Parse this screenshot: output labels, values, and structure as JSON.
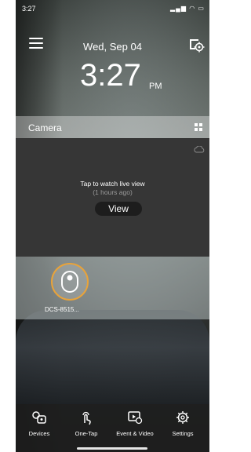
{
  "status_bar": {
    "time": "3:27",
    "icons": "▂▄▆ ◠ ▭"
  },
  "header": {
    "date": "Wed, Sep 04",
    "time": "3:27",
    "ampm": "PM"
  },
  "camera": {
    "section_label": "Camera",
    "tap_text": "Tap to watch live view",
    "ago_text": "(1 hours ago)",
    "view_label": "View"
  },
  "device": {
    "name": "DCS-8515..."
  },
  "nav": [
    {
      "label": "Devices",
      "icon": "devices-icon"
    },
    {
      "label": "One-Tap",
      "icon": "one-tap-icon"
    },
    {
      "label": "Event & Video",
      "icon": "event-video-icon"
    },
    {
      "label": "Settings",
      "icon": "settings-icon"
    }
  ],
  "colors": {
    "accent": "#e8a33a",
    "panel": "#363636",
    "nav_bg": "#1e1e1e"
  }
}
